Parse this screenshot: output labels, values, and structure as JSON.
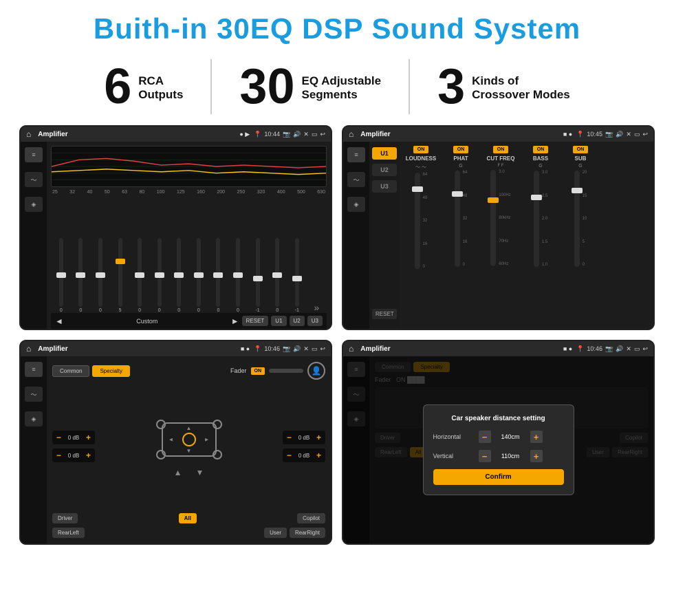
{
  "header": {
    "title": "Buith-in 30EQ DSP Sound System"
  },
  "stats": [
    {
      "number": "6",
      "line1": "RCA",
      "line2": "Outputs"
    },
    {
      "number": "30",
      "line1": "EQ Adjustable",
      "line2": "Segments"
    },
    {
      "number": "3",
      "line1": "Kinds of",
      "line2": "Crossover Modes"
    }
  ],
  "screens": [
    {
      "id": "screen1",
      "topbar": {
        "title": "Amplifier",
        "time": "10:44"
      },
      "type": "eq"
    },
    {
      "id": "screen2",
      "topbar": {
        "title": "Amplifier",
        "time": "10:45"
      },
      "type": "mixer"
    },
    {
      "id": "screen3",
      "topbar": {
        "title": "Amplifier",
        "time": "10:46"
      },
      "type": "crossover"
    },
    {
      "id": "screen4",
      "topbar": {
        "title": "Amplifier",
        "time": "10:46"
      },
      "type": "dialog"
    }
  ],
  "eq": {
    "labels": [
      "25",
      "32",
      "40",
      "50",
      "63",
      "80",
      "100",
      "125",
      "160",
      "200",
      "250",
      "320",
      "400",
      "500",
      "630"
    ],
    "values": [
      "0",
      "0",
      "0",
      "5",
      "0",
      "0",
      "0",
      "0",
      "0",
      "0",
      "-1",
      "0",
      "-1"
    ],
    "bottomBtns": [
      "◄",
      "Custom",
      "►",
      "RESET",
      "U1",
      "U2",
      "U3"
    ]
  },
  "mixer": {
    "uButtons": [
      "U1",
      "U2",
      "U3"
    ],
    "channels": [
      "LOUDNESS",
      "PHAT",
      "CUT FREQ",
      "BASS",
      "SUB"
    ],
    "toggleLabel": "ON",
    "resetLabel": "RESET"
  },
  "crossover": {
    "tabs": [
      "Common",
      "Specialty"
    ],
    "faderLabel": "Fader",
    "onLabel": "ON",
    "bottomBtns": [
      "Driver",
      "All",
      "RearLeft",
      "User",
      "RearRight",
      "Copilot"
    ],
    "dbValues": [
      "0 dB",
      "0 dB",
      "0 dB",
      "0 dB"
    ]
  },
  "dialog": {
    "title": "Car speaker distance setting",
    "horizontalLabel": "Horizontal",
    "horizontalValue": "140cm",
    "verticalLabel": "Vertical",
    "verticalValue": "110cm",
    "confirmLabel": "Confirm"
  }
}
